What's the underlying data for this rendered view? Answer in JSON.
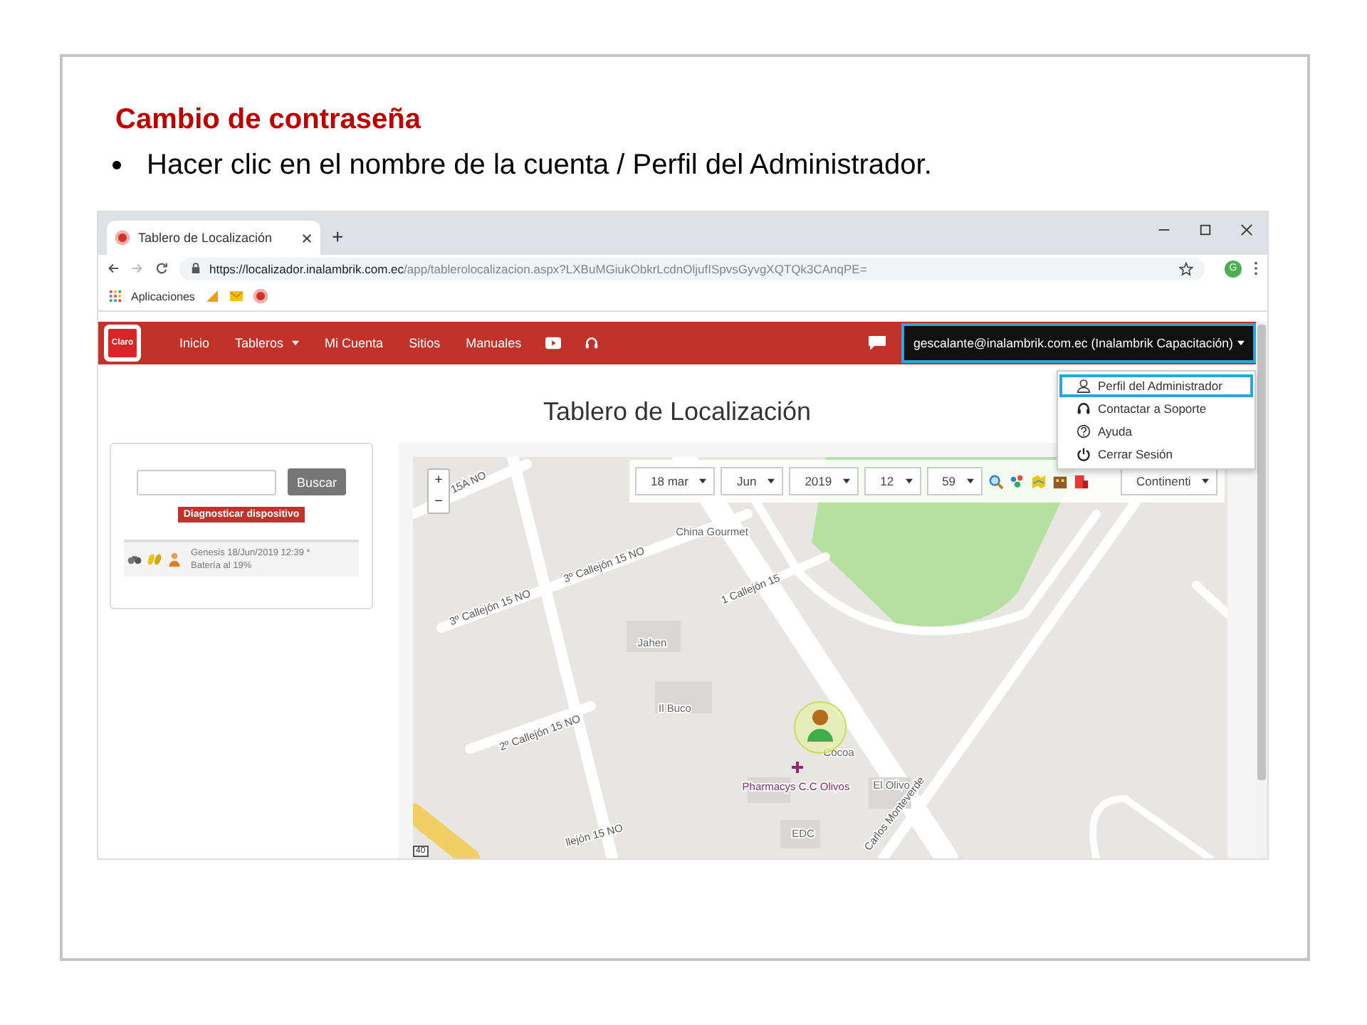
{
  "slide": {
    "title": "Cambio de contraseña",
    "bullets": [
      "Hacer clic en el nombre de la cuenta / Perfil del Administrador."
    ]
  },
  "browser": {
    "tab": {
      "title": "Tablero de Localización"
    },
    "new_tab": "+",
    "url_host": "https://localizador.inalambrik.com.ec",
    "url_path": "/app/tablerolocalizacion.aspx?LXBuMGiukObkrLcdnOljufISpvsGyvgXQTQk3CAnqPE=",
    "profile_initial": "G",
    "bookmarks": [
      "Aplicaciones"
    ]
  },
  "app": {
    "brand": "Claro",
    "nav": [
      {
        "label": "Inicio",
        "dropdown": false
      },
      {
        "label": "Tableros",
        "dropdown": true
      },
      {
        "label": "Mi Cuenta",
        "dropdown": false
      },
      {
        "label": "Sitios",
        "dropdown": false
      },
      {
        "label": "Manuales",
        "dropdown": false
      }
    ],
    "account": {
      "label": "gescalante@inalambrik.com.ec (Inalambrik Capacitación)",
      "highlighted": true
    },
    "account_menu": [
      {
        "label": "Perfil del Administrador",
        "highlighted": true
      },
      {
        "label": "Contactar a Soporte",
        "highlighted": false
      },
      {
        "label": "Ayuda",
        "highlighted": false
      },
      {
        "label": "Cerrar Sesión",
        "highlighted": false
      }
    ],
    "page_title": "Tablero de Localización",
    "search_button": "Buscar",
    "diagnose_button": "Diagnosticar dispositivo",
    "devices": [
      {
        "line1": "Genesis 18/Jun/2019 12:39 *",
        "line2": "Batería al 19%"
      }
    ]
  },
  "map": {
    "filters": [
      "18 mar",
      "Jun",
      "2019",
      "12",
      "59"
    ],
    "region": "Continenti",
    "zoom": [
      "+",
      "−"
    ],
    "scale_badge": "40",
    "labels": [
      {
        "text": "15A NO",
        "kind": "street"
      },
      {
        "text": "China Gourmet",
        "kind": "place"
      },
      {
        "text": "3º Callejón 15 NO",
        "kind": "street"
      },
      {
        "text": "3º Callejón 15 NO",
        "kind": "street"
      },
      {
        "text": "1 Callejón 15",
        "kind": "street"
      },
      {
        "text": "Jahen",
        "kind": "place"
      },
      {
        "text": "Il Buco",
        "kind": "place"
      },
      {
        "text": "2º Callejón 15 NO",
        "kind": "street"
      },
      {
        "text": "Cocoa",
        "kind": "place"
      },
      {
        "text": "Pharmacys C.C Olivos",
        "kind": "pharmacy"
      },
      {
        "text": "El Olivo",
        "kind": "place"
      },
      {
        "text": "EDC",
        "kind": "place"
      },
      {
        "text": "Carlos Monteverde",
        "kind": "street"
      },
      {
        "text": "llejón 15 NO",
        "kind": "street"
      }
    ]
  }
}
